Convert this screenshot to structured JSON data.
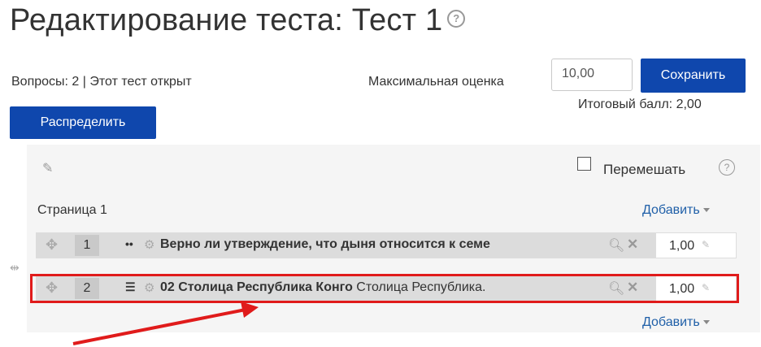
{
  "page": {
    "title": "Редактирование теста: Тест 1",
    "title_help": "?"
  },
  "summary": {
    "info": "Вопросы: 2 | Этот тест открыт",
    "max_grade_label": "Максимальная оценка",
    "max_grade_value": "10,00",
    "save_label": "Сохранить",
    "total_label": "Итоговый балл: 2,00",
    "distribute_label": "Распределить"
  },
  "toolbar": {
    "shuffle_label": "Перемешать",
    "help": "?"
  },
  "section": {
    "page_label": "Страница 1",
    "add_label": "Добавить"
  },
  "questions": [
    {
      "number": "1",
      "type_icon": "true-false-icon",
      "title": "Верно ли утверждение, что дыня относится к семе",
      "description": "",
      "mark": "1,00"
    },
    {
      "number": "2",
      "type_icon": "multichoice-icon",
      "title": "02 Столица Республика Конго",
      "description": " Столица Республика.",
      "mark": "1,00"
    }
  ],
  "colors": {
    "primary_button": "#0f47ad",
    "highlight": "#e01b1b",
    "link": "#1f5fa8"
  }
}
